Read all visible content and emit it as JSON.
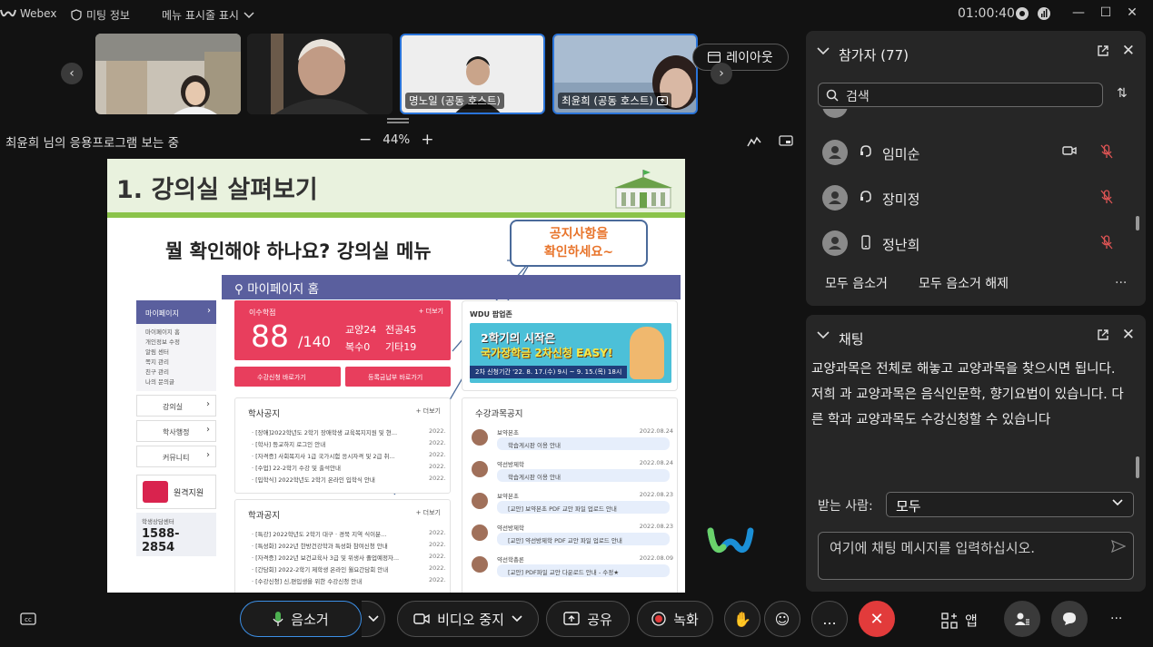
{
  "topbar": {
    "app_name": "Webex",
    "meeting_info": "미팅 정보",
    "menu_display": "메뉴 표시줄 표시",
    "timer": "01:00:40"
  },
  "strip": {
    "participants": [
      {
        "name": ""
      },
      {
        "name": ""
      },
      {
        "name": "명노일 (공동 호스트)"
      },
      {
        "name": "최윤희 (공동 호스트)"
      }
    ],
    "layout_label": "레이아웃"
  },
  "share": {
    "viewing_label": "최윤희 님의 응용프로그램 보는 중",
    "zoom": "44%"
  },
  "slide": {
    "title": "1. 강의실 살펴보기",
    "question": "뭘 확인해야 하나요? 강의실 메뉴",
    "callout_line1": "공지사항을",
    "callout_line2": "확인하세요~",
    "mypage_header": "마이페이지 홈",
    "sidebar": {
      "top": "마이페이지",
      "subs": [
        "마이페이지 홈",
        "개인정보 수정",
        "알림 센터",
        "쪽지 관리",
        "친구 관리",
        "나의 문의글"
      ],
      "items": [
        "강의실",
        "학사행정",
        "커뮤니티"
      ],
      "remote": "원격지원",
      "phone_label": "학생상담센터",
      "phone": "1588-2854"
    },
    "credits": {
      "label": "이수학점",
      "more": "+ 더보기",
      "value": "88",
      "total": "/140",
      "s1": "교양24",
      "s2": "전공45",
      "s3": "복수0",
      "s4": "기타19"
    },
    "btn1": "수강신청 바로가기",
    "btn2": "등록금납부 바로가기",
    "wdu": {
      "title": "WDU 팝업존",
      "line1": "2학기의 시작은",
      "line2": "국가장학금 2차신청 EASY!",
      "line3": "2차 신청기간 '22. 8. 17.(수) 9시 ~ 9. 15.(목) 18시"
    },
    "notice_academic": {
      "title": "학사공지",
      "more": "+ 더보기",
      "rows": [
        {
          "t": "· [장애]2022학년도 2학기 장애학생 교육복지지원 및 현...",
          "d": "2022.08.30"
        },
        {
          "t": "· [학사] 등교하지 로그인 안내",
          "d": "2022.08.31"
        },
        {
          "t": "· [자격증] 사회복지사 1급 국가시험 응시자격 및 2급 취...",
          "d": "2022.08.29"
        },
        {
          "t": "· [수업] 22-2학기 수강 및 출석안내",
          "d": "2022.08.29"
        },
        {
          "t": "· [입학식] 2022학년도 2학기 온라인 입학식 안내",
          "d": "2022.08.26"
        }
      ]
    },
    "notice_dept": {
      "title": "학과공지",
      "more": "+ 더보기",
      "rows": [
        {
          "t": "· [특강] 2022학년도 2학기 대구 · 경북 지역 식이분...",
          "d": "2022.09.05"
        },
        {
          "t": "· [특성화] 2022년 한방건강학과 특성화 참여신청 안내",
          "d": "2022.08.18"
        },
        {
          "t": "· [자격증] 2022년 보건교육사 3급 및 위생사 졸업예정자...",
          "d": "2022.08.18"
        },
        {
          "t": "· [간담회] 2022-2학기 제학생 온라인 월요간담회 안내",
          "d": "2022.08.17"
        },
        {
          "t": "· [수강신청] 신,편입생을 위한 수강신청 안내",
          "d": "2022.08.08"
        }
      ]
    },
    "courses": {
      "title": "수강과목공지",
      "rows": [
        {
          "w": "보약본초",
          "d": "2022.08.24",
          "m": "학습게시판 이용 안내"
        },
        {
          "w": "약선방제학",
          "d": "2022.08.24",
          "m": "학습게시판 이용 안내"
        },
        {
          "w": "보약본초",
          "d": "2022.08.23",
          "m": "[교안] 보약본초 PDF 교안 파일 업로드 안내"
        },
        {
          "w": "약선방제학",
          "d": "2022.08.23",
          "m": "[교안] 약선방제학 PDF 교안 파일 업로드 안내"
        },
        {
          "w": "약선학총론",
          "d": "2022.08.09",
          "m": "[교안] PDF파일 교안 다운로드 안내 - 수정★"
        }
      ]
    }
  },
  "participants_panel": {
    "title": "참가자 (77)",
    "search_placeholder": "검색",
    "list": [
      {
        "name": "임미순"
      },
      {
        "name": "장미정"
      },
      {
        "name": "정난희"
      }
    ],
    "mute_all": "모두 음소거",
    "unmute_all": "모두 음소거 해제",
    "more": "..."
  },
  "chat_panel": {
    "title": "채팅",
    "message": "교양과목은 전체로 해놓고 교양과목을 찾으시면 됩니다. 저희 과 교양과목은 음식인문학, 향기요법이 있습니다. 다른 학과 교양과목도 수강신청할 수 있습니다",
    "to_label": "받는 사람:",
    "to_value": "모두",
    "input_placeholder": "여기에 채팅 메시지를 입력하십시오."
  },
  "bottombar": {
    "mute": "음소거",
    "video": "비디오 중지",
    "share": "공유",
    "record": "녹화",
    "apps": "앱",
    "more": "..."
  },
  "colors": {
    "accent": "#2a74d9",
    "leave_red": "#e23b3b",
    "mute_green": "#4caf50",
    "slide_title_bg": "#e9f2de",
    "slide_green_bar": "#8bc34a",
    "mypage_purple": "#5a5f9e",
    "credit_pink": "#e83e5d",
    "callout_orange": "#e8742b"
  },
  "icons": [
    "webex-logo-icon",
    "shield-icon",
    "chevron-down-icon",
    "timer-icon",
    "stats-icon",
    "minimize-icon",
    "maximize-icon",
    "close-icon",
    "arrow-left-icon",
    "arrow-right-icon",
    "layout-icon",
    "annotate-icon",
    "popout-icon",
    "search-icon",
    "sort-icon",
    "headset-icon",
    "phone-icon",
    "video-icon",
    "mic-muted-icon",
    "send-icon",
    "cc-icon",
    "mic-icon",
    "camera-icon",
    "share-icon",
    "record-icon",
    "raise-hand-icon",
    "reaction-icon",
    "more-icon",
    "end-call-icon",
    "apps-icon",
    "participants-icon",
    "chat-icon"
  ]
}
